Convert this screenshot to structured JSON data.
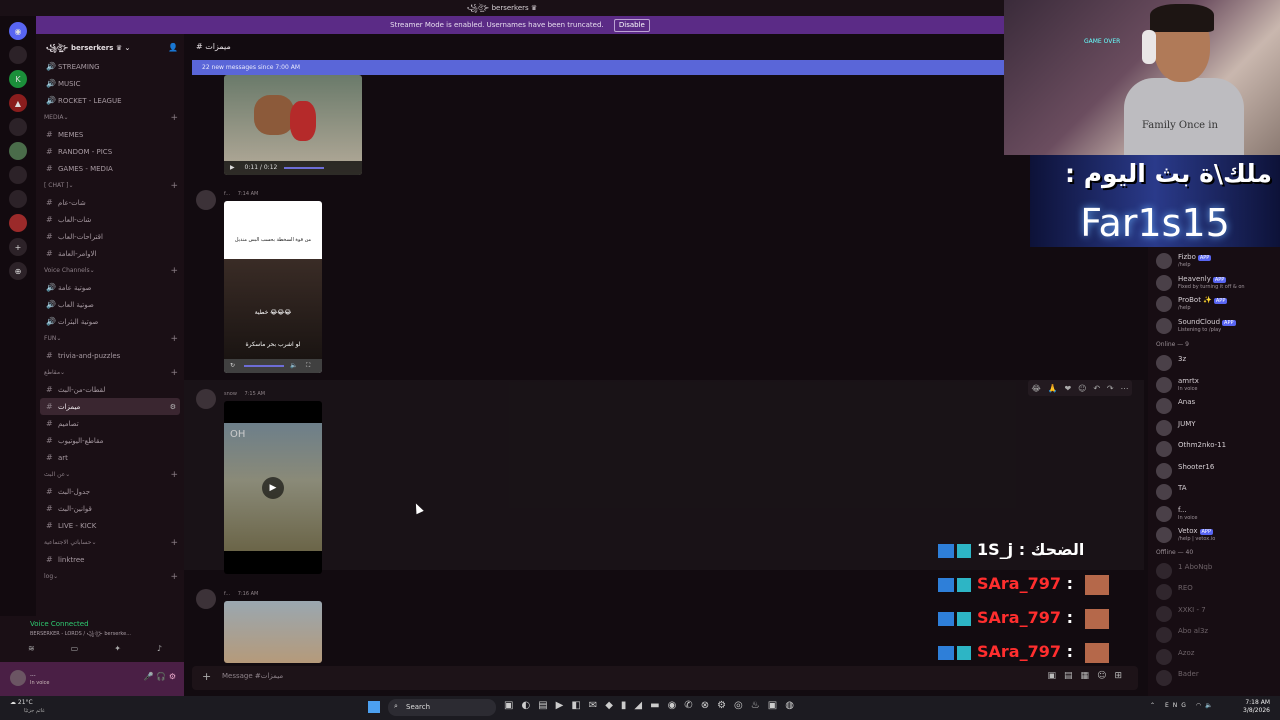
{
  "window": {
    "title": "꧁ঔৣ⊱ berserkers ♛"
  },
  "streamer_banner": {
    "text": "Streamer Mode is enabled. Usernames have been truncated.",
    "disable_label": "Disable"
  },
  "server": {
    "name": "꧁ঔৣ⊱ berserkers ♛"
  },
  "sidebar": {
    "items": [
      {
        "type": "channel",
        "sym": "🔊",
        "label": "STREAMING"
      },
      {
        "type": "channel",
        "sym": "🔊",
        "label": "MUSIC"
      },
      {
        "type": "channel",
        "sym": "🔊",
        "label": "ROCKET - LEAGUE"
      },
      {
        "type": "category",
        "label": "MEDIA"
      },
      {
        "type": "channel",
        "sym": "#",
        "label": "MEMES"
      },
      {
        "type": "channel",
        "sym": "#",
        "label": "RANDOM - PICS"
      },
      {
        "type": "channel",
        "sym": "#",
        "label": "GAMES - MEDIA"
      },
      {
        "type": "category",
        "label": "[ CHAT ]"
      },
      {
        "type": "channel",
        "sym": "#",
        "label": "شات-عام"
      },
      {
        "type": "channel",
        "sym": "#",
        "label": "شات-العاب"
      },
      {
        "type": "channel",
        "sym": "#",
        "label": "اقتراحات-العاب"
      },
      {
        "type": "channel",
        "sym": "#",
        "label": "الاوامر-العامة"
      },
      {
        "type": "category",
        "label": "Voice Channels"
      },
      {
        "type": "channel",
        "sym": "🔊",
        "label": "صوتية عامة"
      },
      {
        "type": "channel",
        "sym": "🔊",
        "label": "صوتية العاب"
      },
      {
        "type": "channel",
        "sym": "🔊",
        "label": "صوتية البثرات"
      },
      {
        "type": "category",
        "label": "FUN"
      },
      {
        "type": "channel",
        "sym": "#",
        "label": "trivia-and-puzzles"
      },
      {
        "type": "category",
        "label": "مقاطع"
      },
      {
        "type": "channel",
        "sym": "#",
        "label": "لقطات-من-البث"
      },
      {
        "type": "channel",
        "sym": "#",
        "label": "ميمزات",
        "active": true
      },
      {
        "type": "channel",
        "sym": "#",
        "label": "تصاميم"
      },
      {
        "type": "channel",
        "sym": "#",
        "label": "مقاطع-اليوتيوب"
      },
      {
        "type": "channel",
        "sym": "#",
        "label": "art"
      },
      {
        "type": "category",
        "label": "عن البث"
      },
      {
        "type": "channel",
        "sym": "#",
        "label": "جدول-البث"
      },
      {
        "type": "channel",
        "sym": "#",
        "label": "قوانين-البث"
      },
      {
        "type": "channel",
        "sym": "#",
        "label": "LIVE - KICK"
      },
      {
        "type": "category",
        "label": "حساباتي الاجتماعية"
      },
      {
        "type": "channel",
        "sym": "#",
        "label": "linktree"
      },
      {
        "type": "category",
        "label": "log"
      }
    ]
  },
  "voice": {
    "status": "Voice Connected",
    "detail": "BERSERKER - LORDS / ꧁ঔৣ⊱ berserke..."
  },
  "user": {
    "name": "...",
    "status": "In voice"
  },
  "channel_header": {
    "name": "ميمزات"
  },
  "new_messages": {
    "text": "22 new messages since 7:00 AM"
  },
  "messages": [
    {
      "author": "",
      "time": "",
      "video_time": "0:11 / 0:12"
    },
    {
      "author": "f...",
      "time": "7:14 AM",
      "caption": "من قوة السخطة بحسب البس منديل",
      "sub": "خطية 😂😂😂",
      "sub2": "لو اشرب بحر ماسكرة"
    },
    {
      "author": "snow",
      "time": "7:15 AM",
      "overlay": "OH"
    },
    {
      "author": "f...",
      "time": "7:16 AM"
    }
  ],
  "composer": {
    "placeholder": "Message #ميمزات"
  },
  "members": {
    "apps": [
      {
        "name": "Fizbo",
        "sub": "/help",
        "app": "APP"
      },
      {
        "name": "Heavenly",
        "sub": "Fixed by turning it off & on",
        "app": "APP"
      },
      {
        "name": "ProBot ✨",
        "sub": "/help",
        "app": "APP"
      },
      {
        "name": "SoundCloud",
        "sub": "Listening to /play",
        "app": "APP"
      }
    ],
    "online_header": "Online — 9",
    "online": [
      {
        "name": "3z",
        "sub": ""
      },
      {
        "name": "amrtx",
        "sub": "In voice"
      },
      {
        "name": "Anas",
        "sub": ""
      },
      {
        "name": "JUMY",
        "sub": ""
      },
      {
        "name": "Othm2nko-11",
        "sub": ""
      },
      {
        "name": "Shooter16",
        "sub": ""
      },
      {
        "name": "TA",
        "sub": ""
      },
      {
        "name": "f...",
        "sub": "In voice"
      },
      {
        "name": "Vetox",
        "sub": "/help | vetox.io",
        "app": "APP"
      }
    ],
    "offline_header": "Offline — 40",
    "offline": [
      {
        "name": "1 AboNqb"
      },
      {
        "name": "REO"
      },
      {
        "name": "XXKI - 7"
      },
      {
        "name": "Abo al3z"
      },
      {
        "name": "Azoz"
      },
      {
        "name": "Bader"
      }
    ]
  },
  "stream_overlay": {
    "banner_top": "ملك\\ة بث اليوم :",
    "banner_name": "Far1s15",
    "chat": [
      {
        "user": "1S_j",
        "msg": "الضحك",
        "color": "#ffffff"
      },
      {
        "user": "SAra_797",
        "msg": "",
        "color": "#ff2e2e"
      },
      {
        "user": "SAra_797",
        "msg": "",
        "color": "#ff2e2e"
      },
      {
        "user": "SAra_797",
        "msg": "",
        "color": "#ff2e2e"
      }
    ],
    "cam_shirt_text": "Family Once in",
    "cam_sign": "GAME OVER"
  },
  "taskbar": {
    "weather_temp": "21°C",
    "weather_desc": "غائم جزئيًا",
    "search_label": "Search",
    "lang": "ENG",
    "time": "7:18 AM",
    "date": "3/8/2026"
  }
}
